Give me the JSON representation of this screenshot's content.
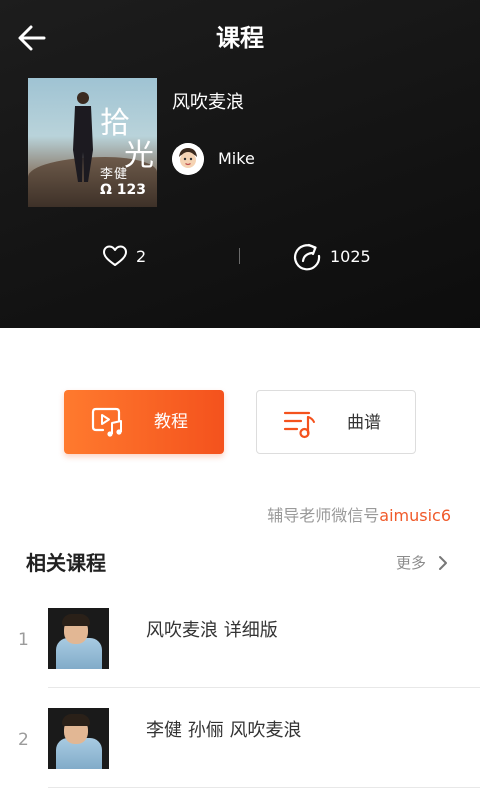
{
  "header": {
    "title": "课程",
    "back_icon": "back-arrow-icon"
  },
  "course": {
    "cover_text_main": [
      "拾",
      "光"
    ],
    "cover_text_artist": [
      "李",
      "健"
    ],
    "cover_badge": "123",
    "song_title": "风吹麦浪",
    "author_name": "Mike",
    "likes": "2",
    "shares": "1025"
  },
  "actions": {
    "tutorial_label": "教程",
    "score_label": "曲谱",
    "tutorial_icon": "video-music-icon",
    "score_icon": "music-score-icon",
    "accent_start": "#ff7a2e",
    "accent_end": "#f4521d"
  },
  "tutor_note": {
    "prefix": "辅导老师微信号",
    "wechat": "aimusic6"
  },
  "related": {
    "title": "相关课程",
    "more_label": "更多",
    "items": [
      {
        "index": "1",
        "name": "风吹麦浪 详细版"
      },
      {
        "index": "2",
        "name": "李健 孙俪 风吹麦浪"
      }
    ]
  }
}
